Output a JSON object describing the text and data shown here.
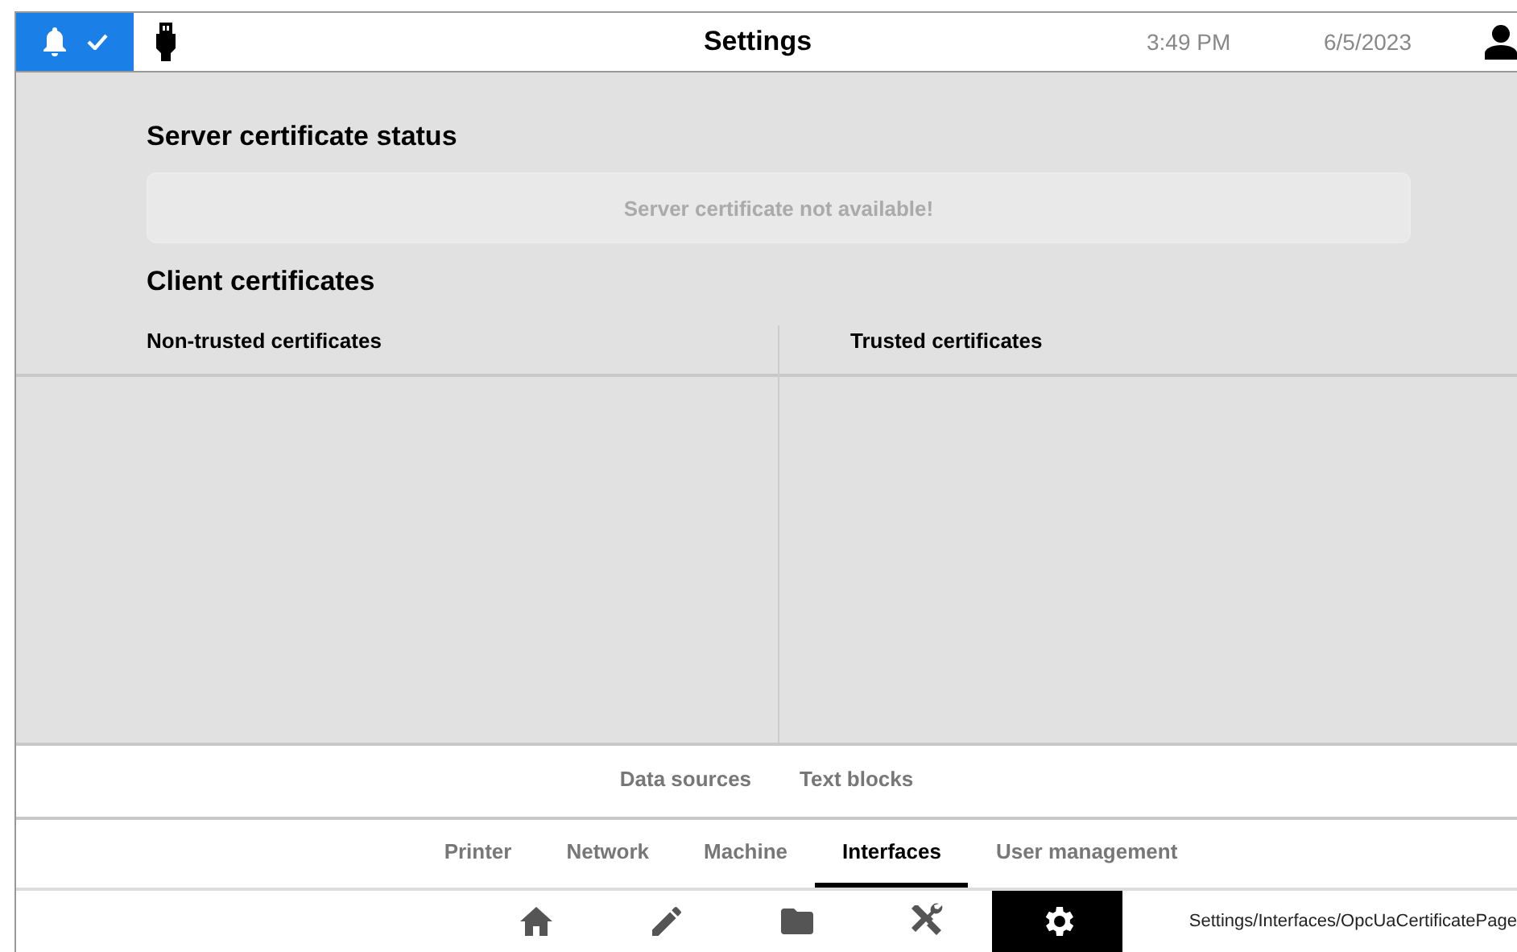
{
  "top_bar": {
    "title": "Settings",
    "time": "3:49 PM",
    "date": "6/5/2023"
  },
  "server_certificate": {
    "heading": "Server certificate status",
    "message": "Server certificate not available!"
  },
  "client_certificates": {
    "heading": "Client certificates",
    "columns": [
      "Non-trusted certificates",
      "Trusted certificates"
    ]
  },
  "sub_tabs": [
    {
      "label": "Data sources",
      "selected": false
    },
    {
      "label": "Text blocks",
      "selected": false
    }
  ],
  "main_tabs": [
    {
      "label": "Printer",
      "selected": false
    },
    {
      "label": "Network",
      "selected": false
    },
    {
      "label": "Machine",
      "selected": false
    },
    {
      "label": "Interfaces",
      "selected": true
    },
    {
      "label": "User management",
      "selected": false
    }
  ],
  "nav": [
    {
      "kind": "home",
      "selected": false
    },
    {
      "kind": "edit",
      "selected": false
    },
    {
      "kind": "folder",
      "selected": false
    },
    {
      "kind": "tools",
      "selected": false
    },
    {
      "kind": "settings",
      "selected": true
    }
  ],
  "breadcrumb": "Settings/Interfaces/OpcUaCertificatePage"
}
